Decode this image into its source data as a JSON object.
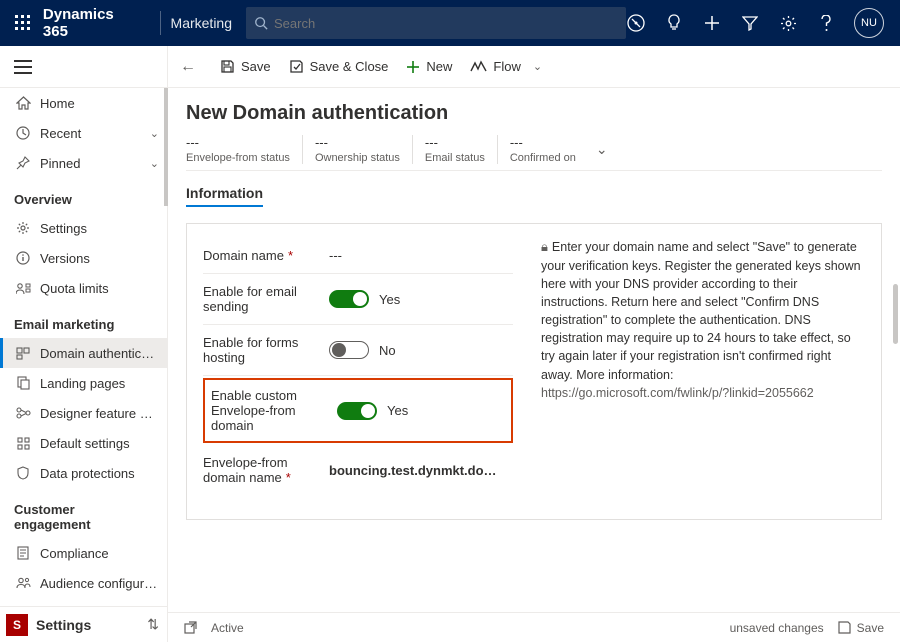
{
  "top": {
    "app": "Dynamics 365",
    "sub": "Marketing",
    "search_placeholder": "Search",
    "avatar": "NU"
  },
  "sidebar": {
    "home": "Home",
    "recent": "Recent",
    "pinned": "Pinned",
    "groups": [
      {
        "title": "Overview",
        "items": [
          {
            "label": "Settings",
            "icon": "gear"
          },
          {
            "label": "Versions",
            "icon": "info"
          },
          {
            "label": "Quota limits",
            "icon": "quota"
          }
        ]
      },
      {
        "title": "Email marketing",
        "items": [
          {
            "label": "Domain authentic…",
            "icon": "domain",
            "active": true
          },
          {
            "label": "Landing pages",
            "icon": "pages"
          },
          {
            "label": "Designer feature …",
            "icon": "designer"
          },
          {
            "label": "Default settings",
            "icon": "defaults"
          },
          {
            "label": "Data protections",
            "icon": "shield"
          }
        ]
      },
      {
        "title": "Customer engagement",
        "items": [
          {
            "label": "Compliance",
            "icon": "compliance"
          },
          {
            "label": "Audience configur…",
            "icon": "audience"
          }
        ]
      }
    ],
    "bottom": {
      "letter": "S",
      "label": "Settings"
    }
  },
  "cmd": {
    "save": "Save",
    "saveclose": "Save & Close",
    "new": "New",
    "flow": "Flow"
  },
  "page": {
    "title": "New Domain authentication",
    "status": [
      {
        "val": "---",
        "cap": "Envelope-from status"
      },
      {
        "val": "---",
        "cap": "Ownership status"
      },
      {
        "val": "---",
        "cap": "Email status"
      },
      {
        "val": "---",
        "cap": "Confirmed on"
      }
    ],
    "tab": "Information",
    "form": {
      "domain_label": "Domain name",
      "domain_val": "---",
      "email_label": "Enable for email sending",
      "email_val": "Yes",
      "forms_label": "Enable for forms hosting",
      "forms_val": "No",
      "custom_label": "Enable custom Envelope-from domain",
      "custom_val": "Yes",
      "envfrom_label": "Envelope-from domain name",
      "envfrom_val": "bouncing.test.dynmkt.do…"
    },
    "help": {
      "text": "Enter your domain name and select \"Save\" to generate your verification keys. Register the generated keys shown here with your DNS provider according to their instructions. Return here and select \"Confirm DNS registration\" to complete the authentication. DNS registration may require up to 24 hours to take effect, so try again later if your registration isn't confirmed right away. More information:",
      "link": "https://go.microsoft.com/fwlink/p/?linkid=2055662"
    }
  },
  "statusbar": {
    "state": "Active",
    "unsaved": "unsaved changes",
    "save": "Save"
  }
}
